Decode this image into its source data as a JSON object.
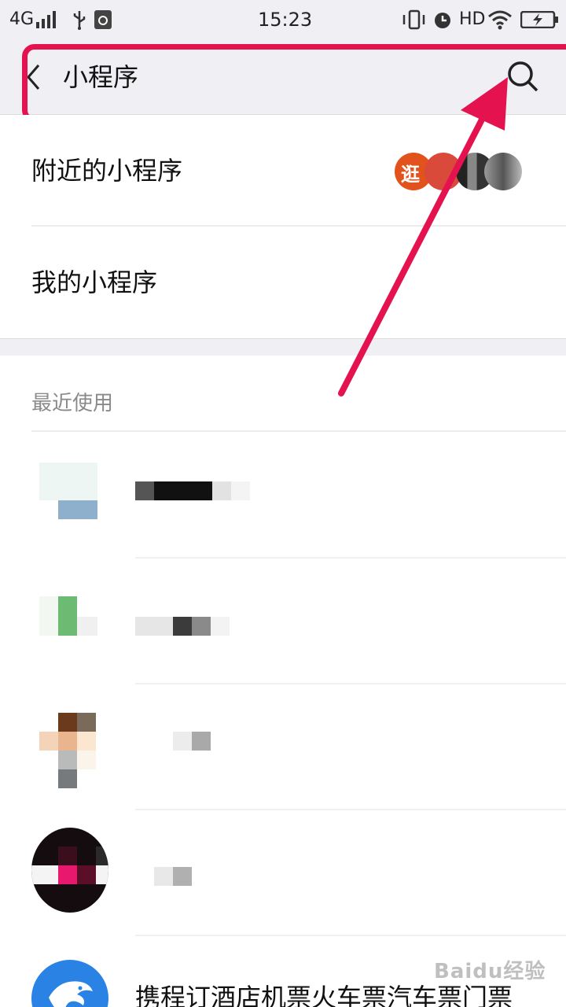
{
  "status_bar": {
    "network": "4G",
    "time": "15:23",
    "hd": "HD"
  },
  "search": {
    "query": "小程序"
  },
  "menu": {
    "nearby_label": "附近的小程序",
    "mine_label": "我的小程序"
  },
  "recent": {
    "header": "最近使用",
    "visible_app_name": "携程订酒店机票火车票汽车票门票"
  },
  "watermark": "Baidu经验",
  "colors": {
    "highlight": "#e4124e",
    "ctrip_blue": "#2a82e4"
  }
}
